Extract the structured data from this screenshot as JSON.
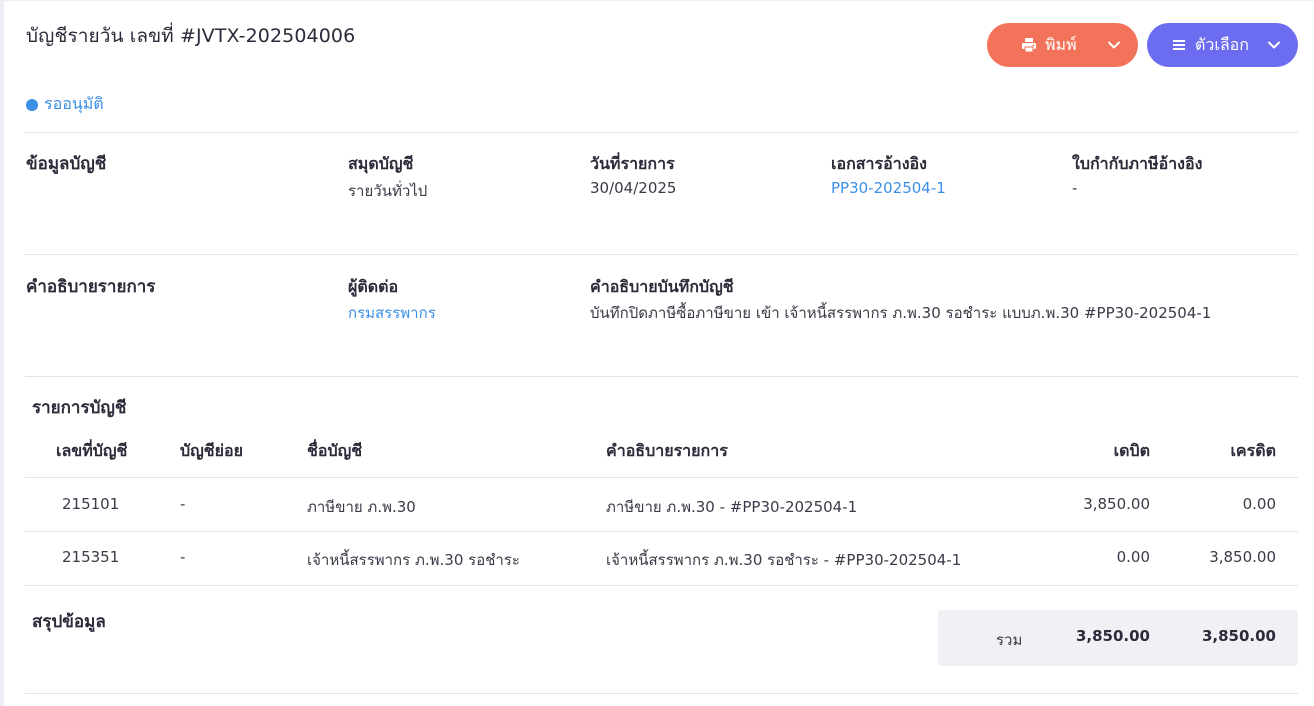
{
  "header": {
    "title": "บัญชีรายวัน เลขที่ #JVTX-202504006",
    "status": "รออนุมัติ"
  },
  "actions": {
    "print_label": "พิมพ์",
    "options_label": "ตัวเลือก"
  },
  "account_info": {
    "section_label": "ข้อมูลบัญชี",
    "ledger_label": "สมุดบัญชี",
    "ledger_value": "รายวันทั่วไป",
    "date_label": "วันที่รายการ",
    "date_value": "30/04/2025",
    "ref_doc_label": "เอกสารอ้างอิง",
    "ref_doc_value": "PP30-202504-1",
    "tax_invoice_label": "ใบกำกับภาษีอ้างอิง",
    "tax_invoice_value": "-"
  },
  "description_info": {
    "section_label": "คำอธิบายรายการ",
    "contact_label": "ผู้ติดต่อ",
    "contact_value": "กรมสรรพากร",
    "note_label": "คำอธิบายบันทึกบัญชี",
    "note_value": "บันทึกปิดภาษีซื้อภาษีขาย เข้า เจ้าหนี้สรรพากร ภ.พ.30 รอชำระ แบบภ.พ.30 #PP30-202504-1"
  },
  "entries": {
    "section_label": "รายการบัญชี",
    "columns": [
      "เลขที่บัญชี",
      "บัญชีย่อย",
      "ชื่อบัญชี",
      "คำอธิบายรายการ",
      "เดบิต",
      "เครดิต"
    ],
    "rows": [
      {
        "account_no": "215101",
        "sub_account": "-",
        "account_name": "ภาษีขาย ภ.พ.30",
        "description": "ภาษีขาย ภ.พ.30 - #PP30-202504-1",
        "debit": "3,850.00",
        "credit": "0.00"
      },
      {
        "account_no": "215351",
        "sub_account": "-",
        "account_name": "เจ้าหนี้สรรพากร ภ.พ.30 รอชำระ",
        "description": "เจ้าหนี้สรรพากร ภ.พ.30 รอชำระ - #PP30-202504-1",
        "debit": "0.00",
        "credit": "3,850.00"
      }
    ]
  },
  "summary": {
    "section_label": "สรุปข้อมูล",
    "total_label": "รวม",
    "total_debit": "3,850.00",
    "total_credit": "3,850.00"
  },
  "colors": {
    "print_button": "#f2735a",
    "options_button": "#6c6cf0",
    "link": "#3b8fe6",
    "status": "#3b8fe6"
  }
}
